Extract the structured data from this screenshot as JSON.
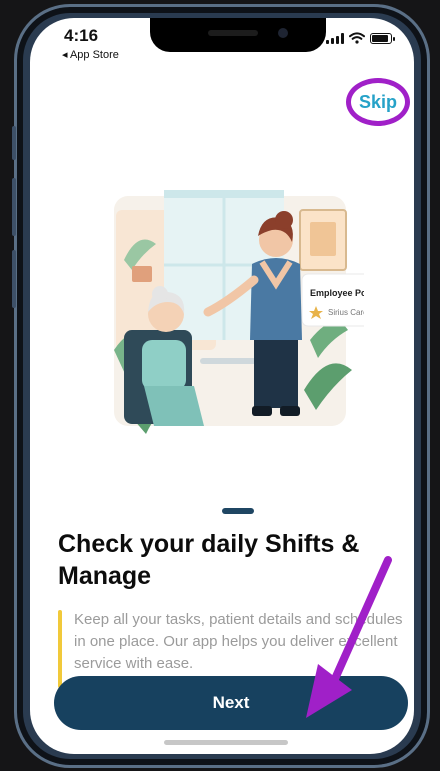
{
  "status_bar": {
    "time": "4:16",
    "back_app": "◂ App Store",
    "battery_level": 0.9
  },
  "skip_label": "Skip",
  "illustration": {
    "card_title": "Employee Portal",
    "card_subtitle": "Sirius Care"
  },
  "onboarding": {
    "page_indicator_active": 1,
    "title": "Check your daily Shifts & Manage",
    "description": "Keep all your tasks, patient details and schedules in one place. Our app helps you deliver excellent service with ease."
  },
  "next_label": "Next",
  "colors": {
    "primary": "#17415f",
    "skip_text": "#26a2c8",
    "highlight": "#a020c8",
    "accent_bar": "#f1c93a"
  }
}
